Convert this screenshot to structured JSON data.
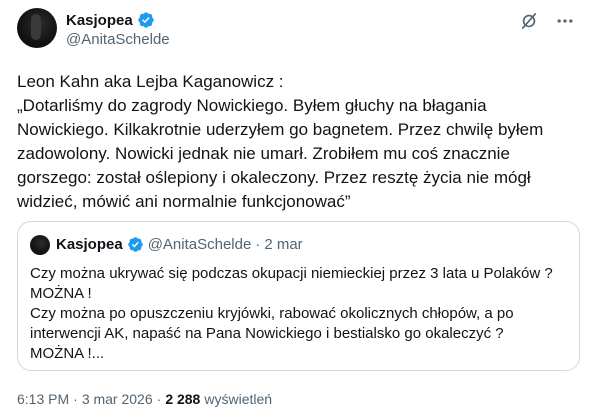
{
  "author": {
    "display_name": "Kasjopea",
    "handle": "@AnitaSchelde",
    "verified_color": "#1d9bf0"
  },
  "header_icons": [
    "grok-icon",
    "more-icon"
  ],
  "tweet": {
    "lines": [
      "Leon Kahn aka Lejba Kaganowicz :",
      "„Dotarliśmy do zagrody Nowickiego. Byłem głuchy na błagania",
      "Nowickiego. Kilkakrotnie uderzyłem go bagnetem. Przez chwilę byłem",
      "zadowolony. Nowicki jednak nie umarł. Zrobiłem mu coś znacznie",
      "gorszego: został oślepiony i okaleczony. Przez resztę życia nie mógł",
      "widzieć, mówić ani normalnie funkcjonować”"
    ]
  },
  "quote": {
    "display_name": "Kasjopea",
    "handle": "@AnitaSchelde",
    "dot": "·",
    "date": "2 mar",
    "lines": [
      "Czy można ukrywać się podczas okupacji niemieckiej przez 3 lata u Polaków ?",
      "MOŻNA !",
      "Czy można po opuszczeniu kryjówki, rabować okolicznych chłopów, a po",
      "interwencji AK, napaść na Pana Nowickiego i bestialsko go okaleczyć ?",
      "MOŻNA !..."
    ]
  },
  "meta": {
    "time": "6:13 PM",
    "sep1": "·",
    "date": "3 mar 2026",
    "sep2": "·",
    "views_count": "2 288",
    "views_label": "wyświetleń"
  }
}
